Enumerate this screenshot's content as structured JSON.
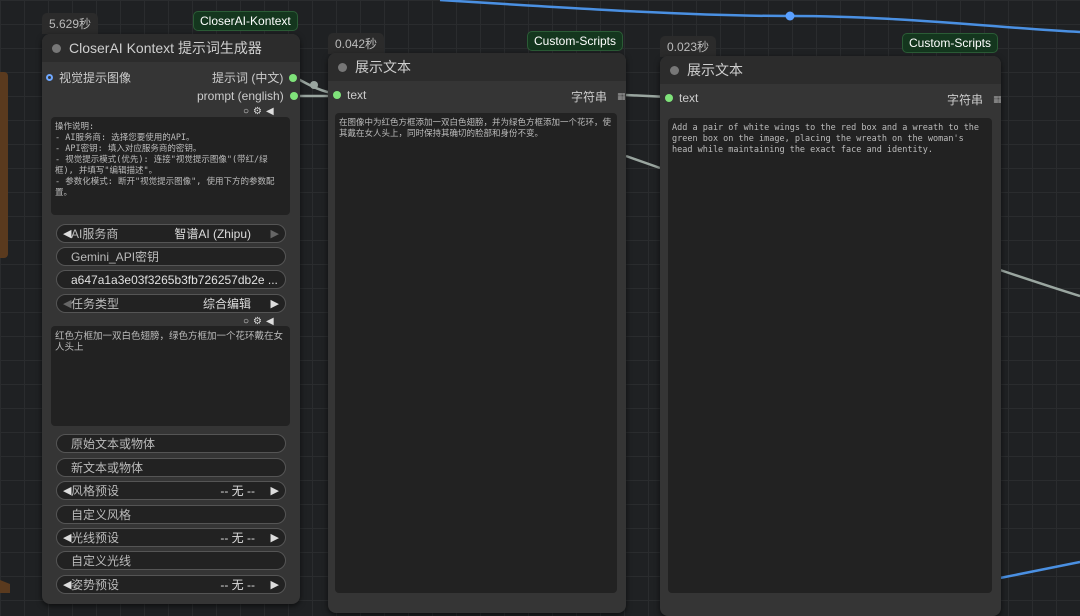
{
  "node1": {
    "timing": "5.629秒",
    "badge": "CloserAI-Kontext",
    "title": "CloserAI Kontext 提示词生成器",
    "input_label": "视觉提示图像",
    "output_1": "提示词 (中文)",
    "output_2": "prompt (english)",
    "instructions": "操作说明:\n- AI服务商: 选择您要使用的API。\n- API密钥: 填入对应服务商的密钥。\n- 视觉提示模式(优先): 连接\"视觉提示图像\"(带红/绿框), 并填写\"编辑描述\"。\n- 参数化模式: 断开\"视觉提示图像\", 使用下方的参数配置。",
    "provider_label": "AI服务商",
    "provider_value": "智谱AI (Zhipu)",
    "api_key_label": "Gemini_API密钥",
    "api_key_value": "a647a1a3e03f3265b3fb726257db2e ...",
    "task_label": "任务类型",
    "task_value": "综合编辑",
    "edit_description": "红色方框加一双白色翅膀，绿色方框加一个花环戴在女人头上",
    "original_text": "原始文本或物体",
    "new_text": "新文本或物体",
    "style_preset_label": "风格预设",
    "style_preset_value": "-- 无 --",
    "custom_style": "自定义风格",
    "light_preset_label": "光线预设",
    "light_preset_value": "-- 无 --",
    "custom_light": "自定义光线",
    "pose_preset_label": "姿势预设",
    "pose_preset_value": "-- 无 --"
  },
  "node2": {
    "timing": "0.042秒",
    "badge": "Custom-Scripts",
    "title": "展示文本",
    "input_label": "text",
    "output_label": "字符串",
    "content": "在图像中为红色方框添加一双白色翅膀，并为绿色方框添加一个花环，使其戴在女人头上，同时保持其确切的脸部和身份不变。"
  },
  "node3": {
    "timing": "0.023秒",
    "badge": "Custom-Scripts",
    "title": "展示文本",
    "input_label": "text",
    "output_label": "字符串",
    "content": "Add a pair of white wings to the red box and a wreath to the green box on the image, placing the wreath on the woman's head while maintaining the exact face and identity."
  },
  "colors": {
    "canvas": "#1f2123",
    "node_bg": "#353535",
    "badge_bg": "#14361e",
    "port_green": "#7fe37a",
    "wire_blue": "#4a90e2",
    "wire_gray": "#9aa6a0"
  }
}
